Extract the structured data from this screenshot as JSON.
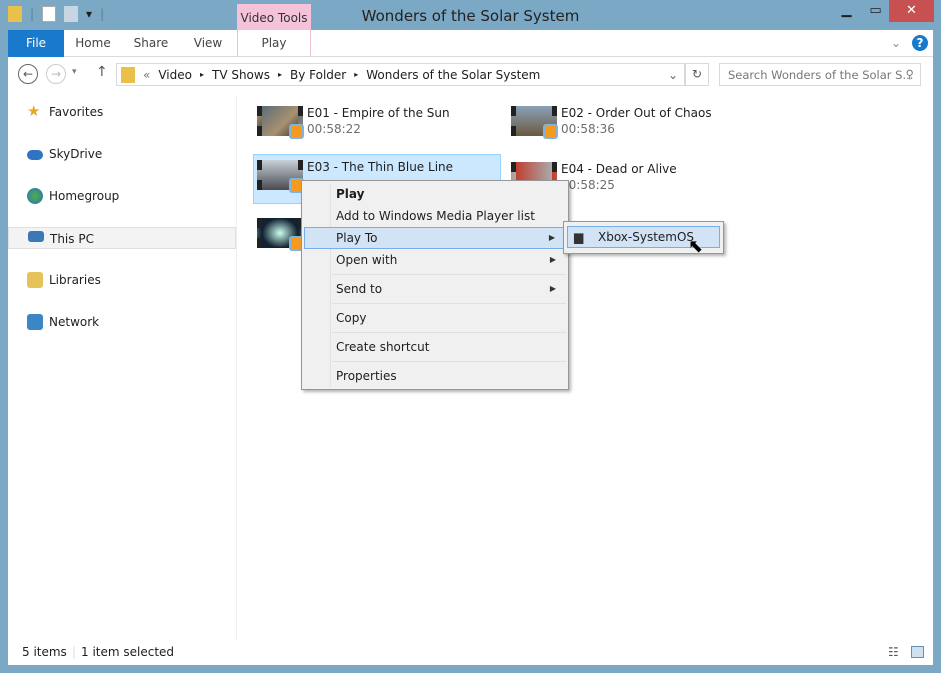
{
  "window": {
    "title": "Wonders of the Solar System",
    "context_tab_group": "Video Tools"
  },
  "ribbon": {
    "tabs": [
      "File",
      "Home",
      "Share",
      "View",
      "Play"
    ]
  },
  "address": {
    "overflow": "«",
    "crumbs": [
      "Video",
      "TV Shows",
      "By Folder",
      "Wonders of the Solar System"
    ]
  },
  "search": {
    "placeholder": "Search Wonders of the Solar S..."
  },
  "nav": {
    "items": [
      "Favorites",
      "SkyDrive",
      "Homegroup",
      "This PC",
      "Libraries",
      "Network"
    ]
  },
  "files": [
    {
      "name": "E01 - Empire of the Sun",
      "duration": "00:58:22"
    },
    {
      "name": "E02 - Order Out of Chaos",
      "duration": "00:58:36"
    },
    {
      "name": "E03 - The Thin Blue Line",
      "duration": "",
      "selected": true
    },
    {
      "name": "E04 - Dead or Alive",
      "duration": "00:58:25"
    },
    {
      "name": "",
      "duration": ""
    }
  ],
  "context_menu": {
    "items": [
      "Play",
      "Add to Windows Media Player list",
      "Play To",
      "Open with",
      "Send to",
      "Copy",
      "Create shortcut",
      "Properties"
    ],
    "highlighted": "Play To"
  },
  "submenu": {
    "items": [
      "Xbox-SystemOS"
    ]
  },
  "status": {
    "count": "5 items",
    "selection": "1 item selected"
  },
  "colors": {
    "frame": "#7ba8c5",
    "file_tab": "#1979ca",
    "context_tab": "#f4c3d9",
    "close": "#c75050",
    "selection": "#cce8ff"
  }
}
